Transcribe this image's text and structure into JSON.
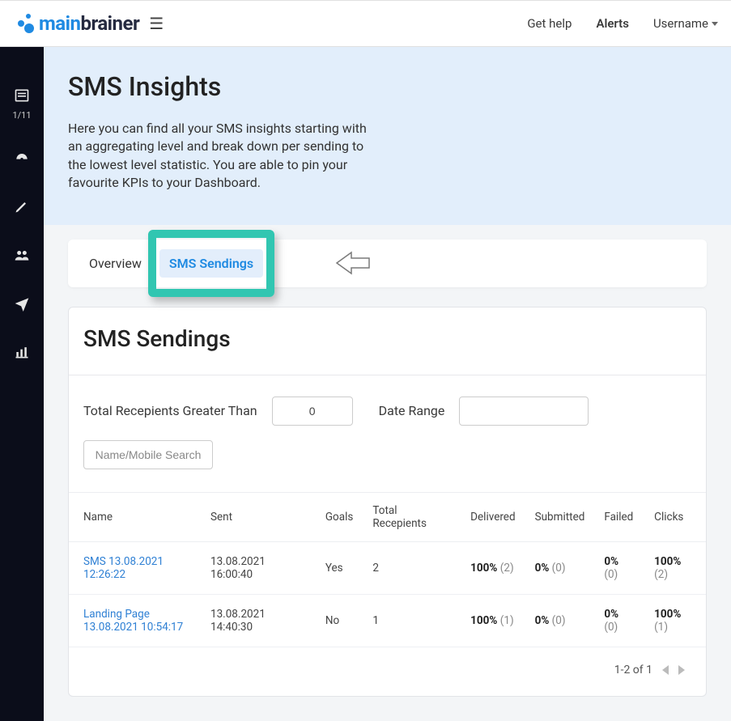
{
  "header": {
    "brand_main": "main",
    "brand_accent": "brainer",
    "get_help": "Get help",
    "alerts": "Alerts",
    "username": "Username"
  },
  "sidebar": {
    "progress": "1/11"
  },
  "hero": {
    "title": "SMS Insights",
    "description": "Here you can find all your SMS insights starting with an aggregating level and break down per sending to the lowest level statistic. You are able to pin your favourite KPIs to your Dashboard."
  },
  "tabs": {
    "overview": "Overview",
    "sendings": "SMS Sendings"
  },
  "panel": {
    "title": "SMS Sendings",
    "filters": {
      "recipients_label": "Total Recepients Greater Than",
      "recipients_value": "0",
      "date_range_label": "Date Range",
      "date_range_value": "",
      "search_placeholder": "Name/Mobile Search"
    },
    "columns": {
      "name": "Name",
      "sent": "Sent",
      "goals": "Goals",
      "total_recipients": "Total Recepients",
      "delivered": "Delivered",
      "submitted": "Submitted",
      "failed": "Failed",
      "clicks": "Clicks"
    },
    "rows": [
      {
        "name": "SMS 13.08.2021 12:26:22",
        "sent": "13.08.2021 16:00:40",
        "goals": "Yes",
        "total_recipients": "2",
        "delivered_pct": "100%",
        "delivered_cnt": "(2)",
        "submitted_pct": "0%",
        "submitted_cnt": "(0)",
        "failed_pct": "0%",
        "failed_cnt": "(0)",
        "clicks_pct": "100%",
        "clicks_cnt": "(2)"
      },
      {
        "name": "Landing Page 13.08.2021 10:54:17",
        "sent": "13.08.2021 14:40:30",
        "goals": "No",
        "total_recipients": "1",
        "delivered_pct": "100%",
        "delivered_cnt": "(1)",
        "submitted_pct": "0%",
        "submitted_cnt": "(0)",
        "failed_pct": "0%",
        "failed_cnt": "(0)",
        "clicks_pct": "100%",
        "clicks_cnt": "(1)"
      }
    ],
    "pager": "1-2 of 1"
  }
}
